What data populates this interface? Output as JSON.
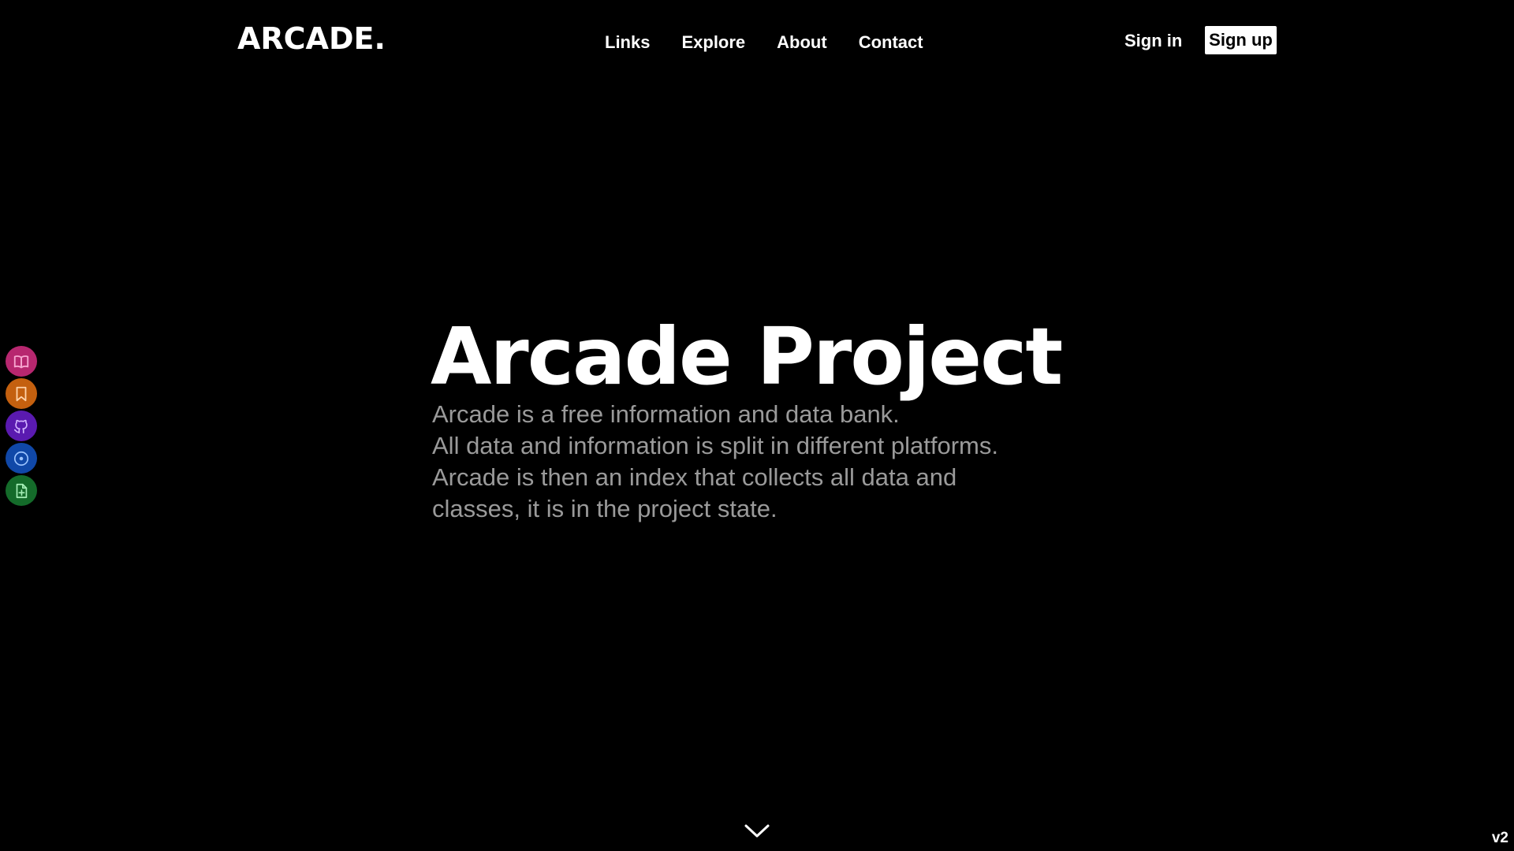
{
  "header": {
    "logo": "ARCADE.",
    "nav": [
      "Links",
      "Explore",
      "About",
      "Contact"
    ],
    "sign_in": "Sign in",
    "sign_up": "Sign up"
  },
  "dock": [
    {
      "icon": "book-icon",
      "color": "#b7276f"
    },
    {
      "icon": "bookmark-icon",
      "color": "#c4600f"
    },
    {
      "icon": "github-icon",
      "color": "#5a1ab0"
    },
    {
      "icon": "compass-icon",
      "color": "#1048a8"
    },
    {
      "icon": "file-add-icon",
      "color": "#146b2a"
    }
  ],
  "hero": {
    "title": "Arcade Project",
    "lines": [
      "Arcade is a free information and data bank.",
      "All data and information is split in different platforms.",
      "Arcade is then an index that collects all data and",
      "classes, it is in the project state."
    ]
  },
  "footer": {
    "scroll_icon": "chevron-down-icon",
    "version": "v2"
  }
}
